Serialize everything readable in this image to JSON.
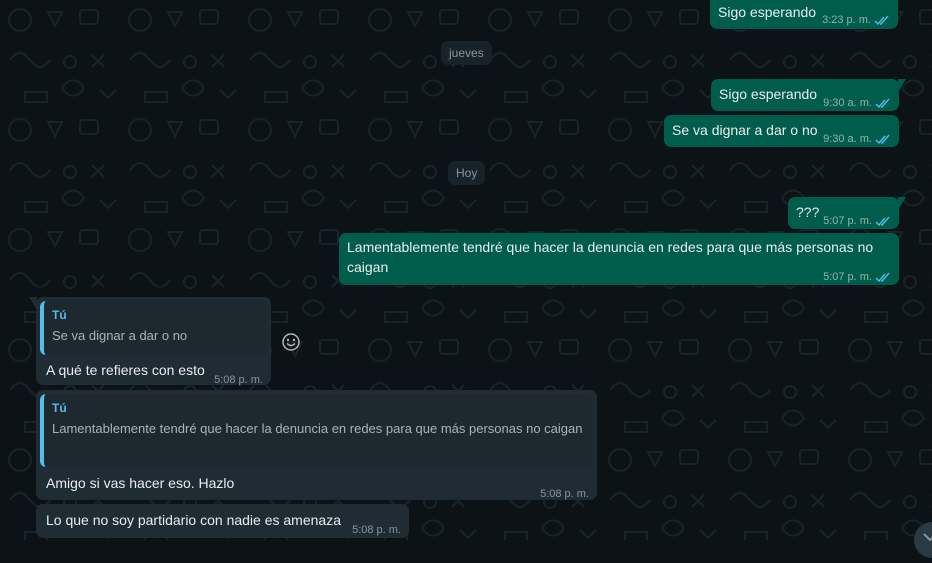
{
  "chat": {
    "day_separators": [
      {
        "label": "jueves"
      },
      {
        "label": "Hoy"
      }
    ],
    "messages": [
      {
        "direction": "outgoing",
        "text": "Sigo esperando",
        "time": "3:23 p. m.",
        "status": "read"
      },
      {
        "direction": "outgoing",
        "text": "Sigo esperando",
        "time": "9:30 a. m.",
        "status": "read"
      },
      {
        "direction": "outgoing",
        "text": "Se va dignar a dar o no",
        "time": "9:30 a. m.",
        "status": "read"
      },
      {
        "direction": "outgoing",
        "text": "???",
        "time": "5:07 p. m.",
        "status": "read"
      },
      {
        "direction": "outgoing",
        "text": "Lamentablemente tendré que hacer la denuncia en redes para que más personas no caigan",
        "time": "5:07 p. m.",
        "status": "read"
      },
      {
        "direction": "incoming",
        "quote": {
          "author": "Tú",
          "text": "Se va dignar a dar o no"
        },
        "text": "A qué te refieres con esto",
        "time": "5:08 p. m."
      },
      {
        "direction": "incoming",
        "quote": {
          "author": "Tú",
          "text": "Lamentablemente tendré que hacer la denuncia en redes para que más personas no caigan"
        },
        "text": "Amigo si vas hacer eso. Hazlo",
        "time": "5:08 p. m."
      },
      {
        "direction": "incoming",
        "text": "Lo que no soy partidario con nadie es amenaza",
        "time": "5:08 p. m."
      }
    ]
  },
  "icons": {
    "read_receipt": "double-check-icon",
    "reaction": "emoji-icon",
    "scroll": "chevron-down-icon"
  },
  "colors": {
    "background": "#0c1317",
    "outgoing_bubble": "#005c4b",
    "incoming_bubble": "#202c33",
    "quote_accent": "#53bdeb",
    "read_tick": "#53bdeb"
  }
}
